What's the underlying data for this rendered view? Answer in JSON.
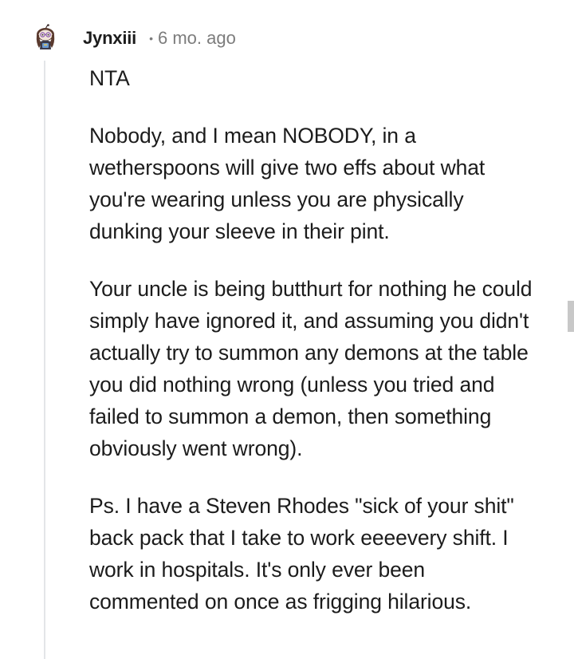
{
  "comment": {
    "username": "Jynxiii",
    "separator": "•",
    "timestamp": "6 mo. ago",
    "avatar_icon": "snoo-avatar-icon",
    "paragraphs": [
      "NTA",
      "Nobody, and I mean NOBODY, in a wetherspoons will give two effs about what you're wearing unless you are physically dunking your sleeve in their pint.",
      "Your uncle is being butthurt for nothing he could simply have ignored it, and assuming you didn't actually try to summon any demons at the table you did nothing wrong (unless you tried and failed to summon a demon, then something obviously went wrong).",
      "Ps. I have a Steven Rhodes \"sick of your shit\" back pack that I take to work eeeevery shift. I work in hospitals. It's only ever been commented on once as frigging hilarious."
    ]
  },
  "colors": {
    "text": "#1c1c1c",
    "meta": "#7c7c7c",
    "thread_line": "#e3e5e8"
  }
}
